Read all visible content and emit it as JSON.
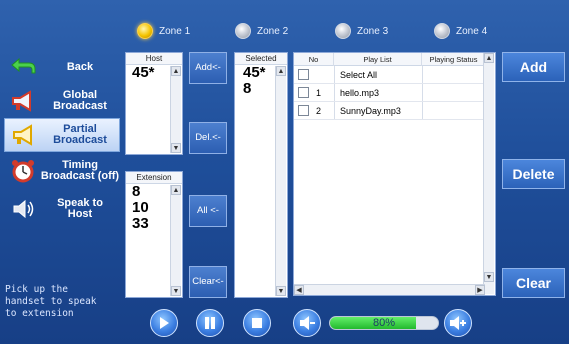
{
  "zones": [
    {
      "label": "Zone 1",
      "active": true
    },
    {
      "label": "Zone 2",
      "active": false
    },
    {
      "label": "Zone 3",
      "active": false
    },
    {
      "label": "Zone 4",
      "active": false
    }
  ],
  "menu": [
    {
      "label": "Back",
      "icon": "back-arrow-icon"
    },
    {
      "label": "Global\nBroadcast",
      "icon": "megaphone-icon"
    },
    {
      "label": "Partial\nBroadcast",
      "icon": "megaphone-icon",
      "active": true
    },
    {
      "label": "Timing\nBroadcast (off)",
      "icon": "alarm-clock-icon"
    },
    {
      "label": "Speak to\nHost",
      "icon": "speaker-icon"
    }
  ],
  "hint": "Pick up the\nhandset to speak\nto extension",
  "host_panel": {
    "title": "Host",
    "items": [
      "45*"
    ]
  },
  "extension_panel": {
    "title": "Extension",
    "items": [
      "8",
      "10",
      "33"
    ]
  },
  "selected_panel": {
    "title": "Selected",
    "items": [
      "45*",
      "8"
    ]
  },
  "mid_buttons": {
    "add": "Add<-",
    "del": "Del.<-",
    "all": "All <-",
    "clear": "Clear<-"
  },
  "playlist": {
    "columns": [
      "No",
      "Play List",
      "Playing Status"
    ],
    "rows": [
      {
        "no": "",
        "name": "Select All",
        "status": ""
      },
      {
        "no": "1",
        "name": "hello.mp3",
        "status": ""
      },
      {
        "no": "2",
        "name": "SunnyDay.mp3",
        "status": ""
      }
    ]
  },
  "right_buttons": {
    "add": "Add",
    "delete": "Delete",
    "clear": "Clear"
  },
  "player": {
    "volume_label": "80%",
    "volume": 0.8
  },
  "colors": {
    "accent": "#2b62b9",
    "zone_active": "#f5c400",
    "volume_fill": "#22b92d"
  }
}
